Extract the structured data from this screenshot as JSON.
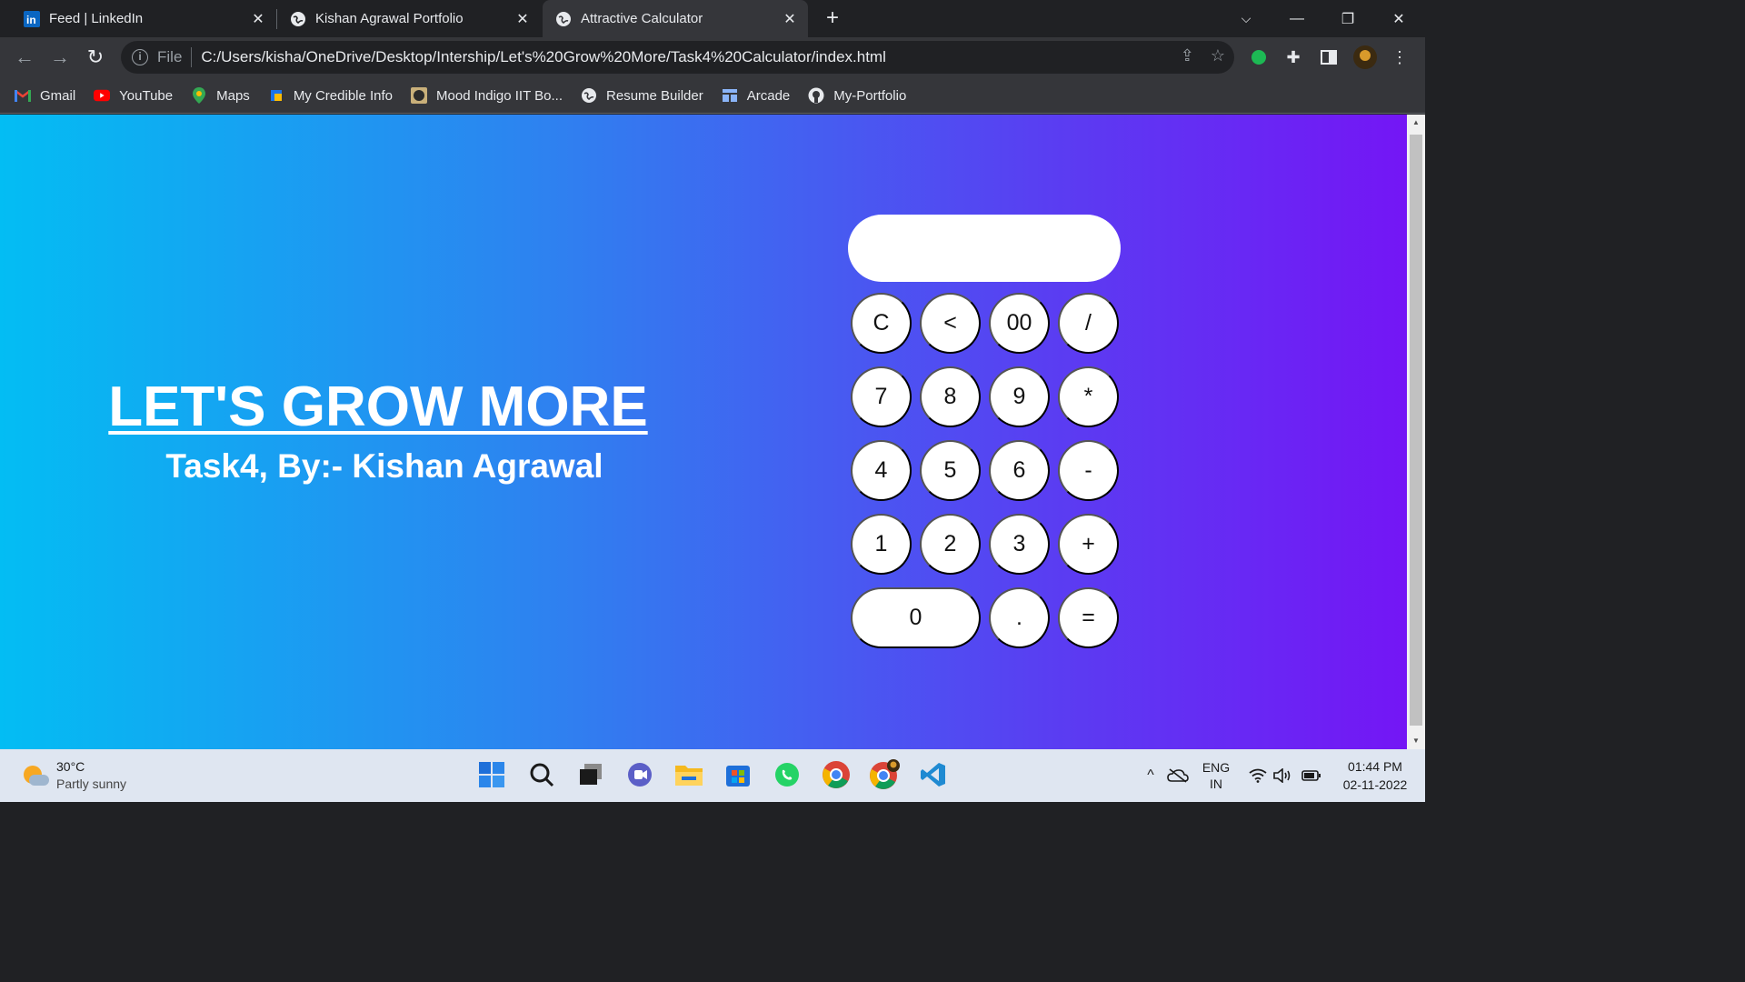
{
  "browser": {
    "tabs": [
      {
        "title": "Feed | LinkedIn",
        "icon": "linkedin-icon",
        "active": false
      },
      {
        "title": "Kishan Agrawal Portfolio",
        "icon": "globe-icon",
        "active": false
      },
      {
        "title": "Attractive Calculator",
        "icon": "globe-icon",
        "active": true
      }
    ],
    "address": {
      "scheme_label": "File",
      "url": "C:/Users/kisha/OneDrive/Desktop/Intership/Let's%20Grow%20More/Task4%20Calculator/index.html"
    },
    "bookmarks": [
      {
        "label": "Gmail",
        "icon": "gmail-icon"
      },
      {
        "label": "YouTube",
        "icon": "youtube-icon"
      },
      {
        "label": "Maps",
        "icon": "maps-icon"
      },
      {
        "label": "My Credible Info",
        "icon": "credible-icon"
      },
      {
        "label": "Mood Indigo IIT Bo...",
        "icon": "mood-indigo-icon"
      },
      {
        "label": "Resume Builder",
        "icon": "globe-icon"
      },
      {
        "label": "Arcade",
        "icon": "arcade-icon"
      },
      {
        "label": "My-Portfolio",
        "icon": "github-icon"
      }
    ]
  },
  "page": {
    "headline": "LET'S GROW MORE",
    "subtitle": "Task4, By:- Kishan Agrawal",
    "display_value": "",
    "keys": {
      "clear": "C",
      "back": "<",
      "double_zero": "00",
      "divide": "/",
      "seven": "7",
      "eight": "8",
      "nine": "9",
      "multiply": "*",
      "four": "4",
      "five": "5",
      "six": "6",
      "minus": "-",
      "one": "1",
      "two": "2",
      "three": "3",
      "plus": "+",
      "zero": "0",
      "dot": ".",
      "equals": "="
    },
    "colors": {
      "gradient_start": "#03bdf3",
      "gradient_end": "#7416f5",
      "key_bg": "#ffffff"
    }
  },
  "taskbar": {
    "weather": {
      "temp": "30°C",
      "condition": "Partly sunny"
    },
    "language": {
      "lang": "ENG",
      "region": "IN"
    },
    "clock": {
      "time": "01:44 PM",
      "date": "02-11-2022"
    }
  }
}
